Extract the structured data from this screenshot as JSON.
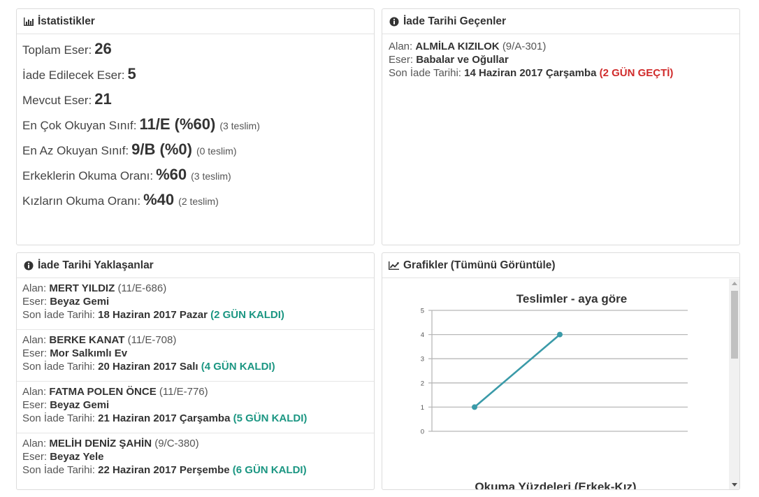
{
  "stats": {
    "title": "İstatistikler",
    "rows": [
      {
        "label": "Toplam Eser:",
        "value": "26",
        "note": ""
      },
      {
        "label": "İade Edilecek Eser:",
        "value": "5",
        "note": ""
      },
      {
        "label": "Mevcut Eser:",
        "value": "21",
        "note": ""
      },
      {
        "label": "En Çok Okuyan Sınıf:",
        "value": "11/E (%60)",
        "note": "(3 teslim)"
      },
      {
        "label": "En Az Okuyan Sınıf:",
        "value": "9/B (%0)",
        "note": "(0 teslim)"
      },
      {
        "label": "Erkeklerin Okuma Oranı:",
        "value": "%60",
        "note": "(3 teslim)"
      },
      {
        "label": "Kızların Okuma Oranı:",
        "value": "%40",
        "note": "(2 teslim)"
      }
    ]
  },
  "overdue": {
    "title": "İade Tarihi Geçenler",
    "labels": {
      "alan": "Alan:",
      "eser": "Eser:",
      "son": "Son İade Tarihi:"
    },
    "items": [
      {
        "name": "ALMİLA KIZILOK",
        "code": "(9/A-301)",
        "book": "Babalar ve Oğullar",
        "date": "14 Haziran 2017 Çarşamba",
        "status": "(2 GÜN GEÇTİ)"
      }
    ]
  },
  "upcoming": {
    "title": "İade Tarihi Yaklaşanlar",
    "labels": {
      "alan": "Alan:",
      "eser": "Eser:",
      "son": "Son İade Tarihi:"
    },
    "items": [
      {
        "name": "MERT YILDIZ",
        "code": "(11/E-686)",
        "book": "Beyaz Gemi",
        "date": "18 Haziran 2017 Pazar",
        "status": "(2 GÜN KALDI)"
      },
      {
        "name": "BERKE KANAT",
        "code": "(11/E-708)",
        "book": "Mor Salkımlı Ev",
        "date": "20 Haziran 2017 Salı",
        "status": "(4 GÜN KALDI)"
      },
      {
        "name": "FATMA POLEN ÖNCE",
        "code": "(11/E-776)",
        "book": "Beyaz Gemi",
        "date": "21 Haziran 2017 Çarşamba",
        "status": "(5 GÜN KALDI)"
      },
      {
        "name": "MELİH DENİZ ŞAHİN",
        "code": "(9/C-380)",
        "book": "Beyaz Yele",
        "date": "22 Haziran 2017 Perşembe",
        "status": "(6 GÜN KALDI)"
      }
    ]
  },
  "charts": {
    "title": "Grafikler",
    "view_all": "(Tümünü Görüntüle)",
    "second_title": "Okuma Yüzdeleri (Erkek-Kız)"
  },
  "colors": {
    "line": "#3a9aa8",
    "grid": "#b8b8b8",
    "overdue": "#d02b2b",
    "remaining": "#1b9682"
  },
  "chart_data": {
    "type": "line",
    "title": "Teslimler - aya göre",
    "xlabel": "",
    "ylabel": "",
    "ylim": [
      0,
      5
    ],
    "yticks": [
      0,
      1,
      2,
      3,
      4,
      5
    ],
    "x": [
      1,
      2
    ],
    "series": [
      {
        "values": [
          1,
          4
        ]
      }
    ],
    "grid": true,
    "legend": "none"
  }
}
